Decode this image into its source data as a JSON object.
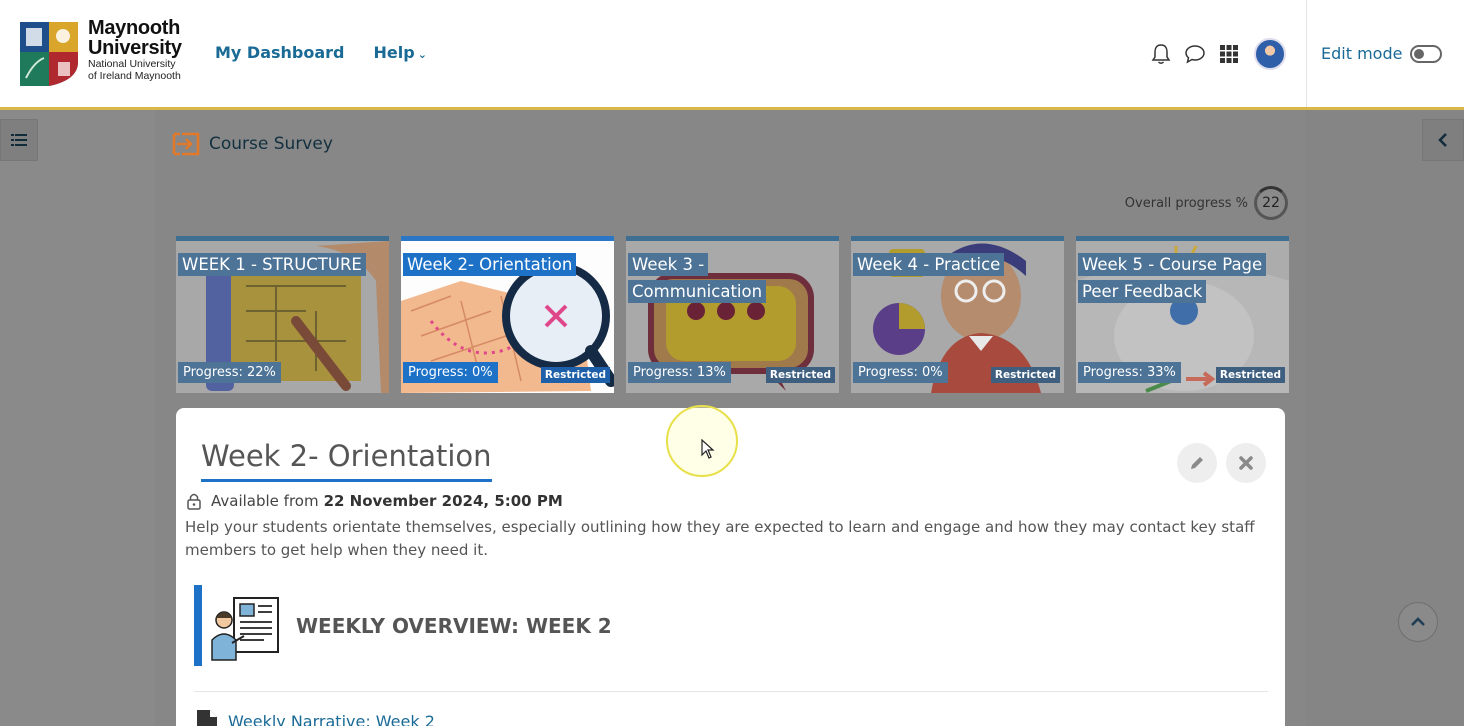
{
  "brand": {
    "line1": "Maynooth",
    "line2": "University",
    "line3": "National University",
    "line4": "of Ireland Maynooth"
  },
  "nav": {
    "dashboard": "My Dashboard",
    "help": "Help"
  },
  "header": {
    "edit_mode_label": "Edit mode",
    "edit_mode_on": false
  },
  "breadcrumb": {
    "text": "Course Survey"
  },
  "overall_progress": {
    "label": "Overall progress %",
    "value": "22"
  },
  "tiles": [
    {
      "title": "WEEK 1 - STRUCTURE",
      "progress": "Progress: 22%",
      "restricted": ""
    },
    {
      "title": "Week 2- Orientation",
      "progress": "Progress: 0%",
      "restricted": "Restricted"
    },
    {
      "title": "Week 3 - Communication",
      "progress": "Progress: 13%",
      "restricted": "Restricted"
    },
    {
      "title": "Week 4 - Practice",
      "progress": "Progress: 0%",
      "restricted": "Restricted"
    },
    {
      "title": "Week 5 - Course Page Peer Feedback",
      "progress": "Progress: 33%",
      "restricted": "Restricted"
    }
  ],
  "section": {
    "title": "Week 2- Orientation",
    "available_prefix": "Available from",
    "available_date": "22 November 2024, 5:00 PM",
    "description": "Help your students orientate themselves, especially outlining how they are expected to learn and engage and how they may contact key staff members to get help when they need it.",
    "overview_title": "WEEKLY OVERVIEW: WEEK 2",
    "narrative_link": "Weekly Narrative: Week 2"
  },
  "colors": {
    "accent_blue": "#1d72c8",
    "link_teal": "#1a6a96",
    "header_rule": "#d8b84a"
  }
}
